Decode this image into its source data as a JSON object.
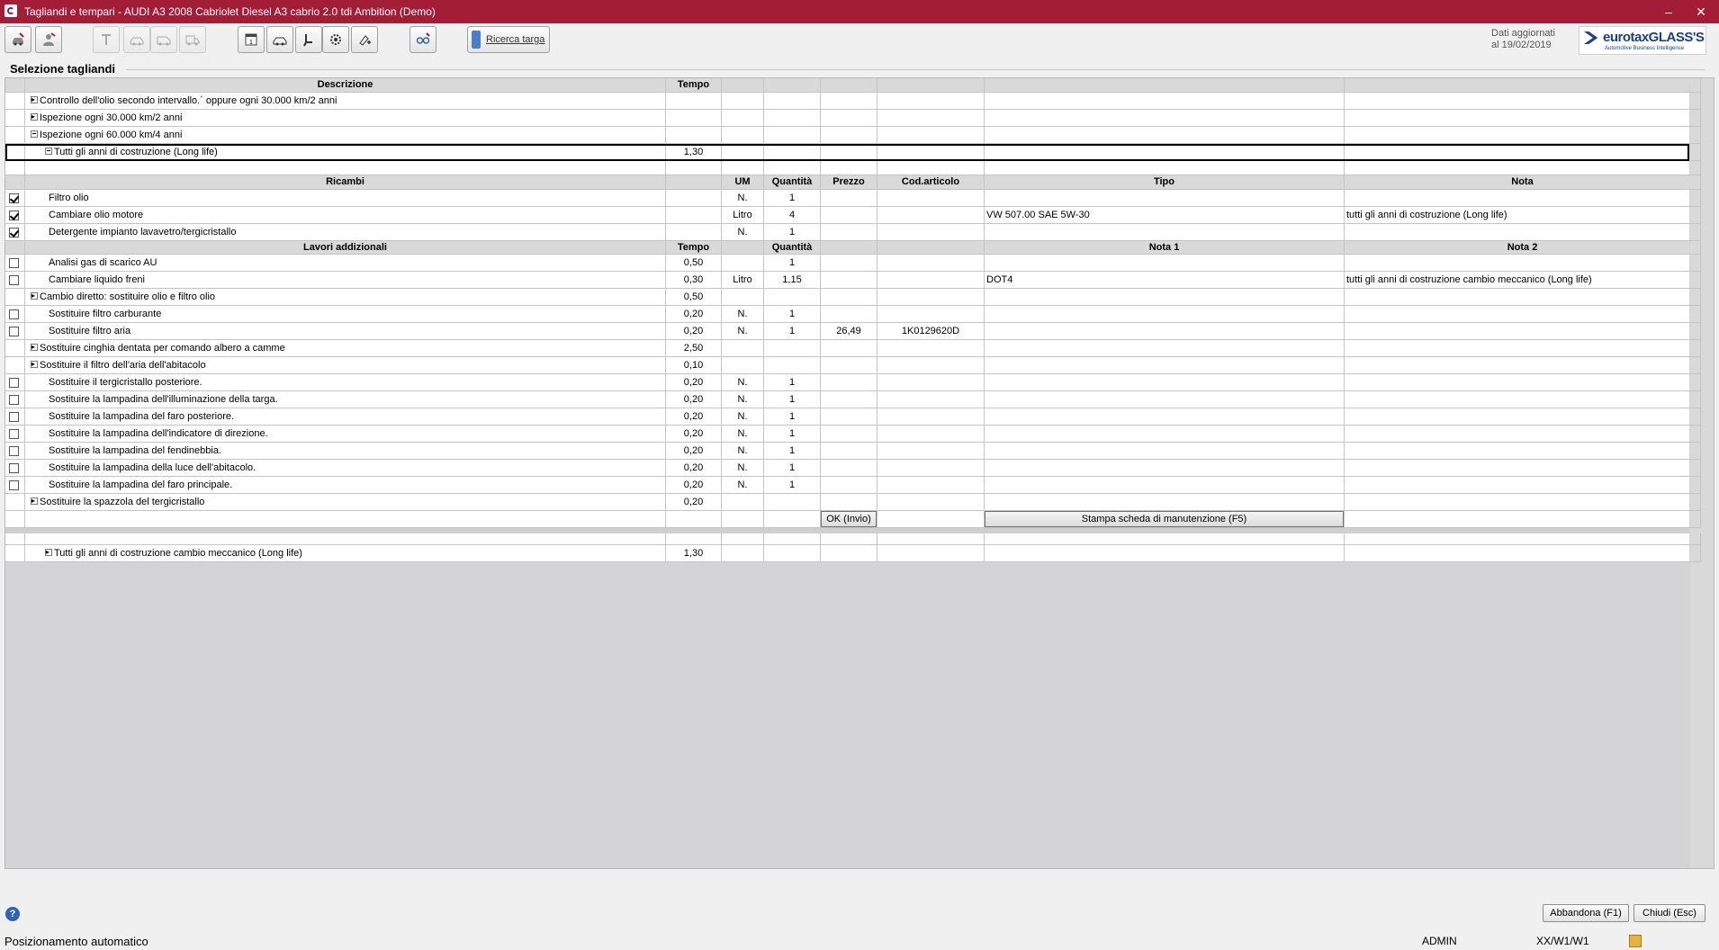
{
  "window": {
    "title": "Tagliandi e tempari - AUDI A3 2008 Cabriolet Diesel A3 cabrio 2.0 tdi Ambition  (Demo)",
    "minimize_icon": "minimize-icon",
    "close_icon": "close-icon"
  },
  "toolbar": {
    "ricerca_label": "Ricerca targa",
    "calendar_day": "1",
    "dati_line1": "Dati aggiornati",
    "dati_line2": "al 19/02/2019",
    "logo_text": "eurotaxGLASS'S",
    "logo_subtitle": "Automotive Business Intelligence"
  },
  "section": {
    "title": "Selezione tagliandi"
  },
  "grid": {
    "header": {
      "descrizione": "Descrizione",
      "tempo": "Tempo"
    },
    "intervals": [
      {
        "label": "Controllo dell'olio secondo intervallo.´ oppure ogni 30.000 km/2 anni",
        "expand": "plus",
        "indent": 0,
        "tempo": ""
      },
      {
        "label": "Ispezione ogni 30.000 km/2 anni",
        "expand": "plus",
        "indent": 0,
        "tempo": ""
      },
      {
        "label": "Ispezione ogni 60.000 km/4 anni",
        "expand": "minus",
        "indent": 0,
        "tempo": ""
      },
      {
        "label": "Tutti gli anni di costruzione (Long life)",
        "expand": "minus",
        "indent": 1,
        "tempo": "1,30"
      }
    ],
    "ricambi_header": {
      "name": "Ricambi",
      "um": "UM",
      "quantita": "Quantità",
      "prezzo": "Prezzo",
      "cod": "Cod.articolo",
      "tipo": "Tipo",
      "nota": "Nota"
    },
    "ricambi": [
      {
        "checked": true,
        "label": "Filtro olio",
        "um": "N.",
        "qty": "1",
        "prezzo": "",
        "cod": "",
        "tipo": "",
        "nota": ""
      },
      {
        "checked": true,
        "label": "Cambiare olio motore",
        "um": "Litro",
        "qty": "4",
        "prezzo": "",
        "cod": "",
        "tipo": "VW 507.00 SAE 5W-30",
        "nota": "tutti gli anni di costruzione (Long life)"
      },
      {
        "checked": true,
        "label": "Detergente impianto lavavetro/tergicristallo",
        "um": "N.",
        "qty": "1",
        "prezzo": "",
        "cod": "",
        "tipo": "",
        "nota": ""
      }
    ],
    "lavori_header": {
      "name": "Lavori addizionali",
      "tempo": "Tempo",
      "quantita": "Quantità",
      "nota1": "Nota 1",
      "nota2": "Nota 2"
    },
    "lavori": [
      {
        "kind": "check",
        "label": "Analisi gas di scarico AU",
        "tempo": "0,50",
        "um": "",
        "qty": "1",
        "prezzo": "",
        "cod": "",
        "nota1": "",
        "nota2": ""
      },
      {
        "kind": "check",
        "label": "Cambiare liquido freni",
        "tempo": "0,30",
        "um": "Litro",
        "qty": "1,15",
        "prezzo": "",
        "cod": "",
        "nota1": "DOT4",
        "nota2": "tutti gli anni di costruzione cambio meccanico (Long life)"
      },
      {
        "kind": "expand",
        "label": "Cambio diretto: sostituire olio e filtro olio",
        "tempo": "0,50",
        "um": "",
        "qty": "",
        "prezzo": "",
        "cod": "",
        "nota1": "",
        "nota2": ""
      },
      {
        "kind": "check",
        "label": "Sostituire filtro carburante",
        "tempo": "0,20",
        "um": "N.",
        "qty": "1",
        "prezzo": "",
        "cod": "",
        "nota1": "",
        "nota2": ""
      },
      {
        "kind": "check",
        "label": "Sostituire filtro aria",
        "tempo": "0,20",
        "um": "N.",
        "qty": "1",
        "prezzo": "26,49",
        "cod": "1K0129620D",
        "nota1": "",
        "nota2": ""
      },
      {
        "kind": "expand",
        "label": "Sostituire cinghia dentata per comando albero a camme",
        "tempo": "2,50",
        "um": "",
        "qty": "",
        "prezzo": "",
        "cod": "",
        "nota1": "",
        "nota2": ""
      },
      {
        "kind": "expand",
        "label": "Sostituire il filtro dell'aria dell'abitacolo",
        "tempo": "0,10",
        "um": "",
        "qty": "",
        "prezzo": "",
        "cod": "",
        "nota1": "",
        "nota2": ""
      },
      {
        "kind": "check",
        "label": "Sostituire il tergicristallo posteriore.",
        "tempo": "0,20",
        "um": "N.",
        "qty": "1",
        "prezzo": "",
        "cod": "",
        "nota1": "",
        "nota2": ""
      },
      {
        "kind": "check",
        "label": "Sostituire la lampadina dell'illuminazione della targa.",
        "tempo": "0,20",
        "um": "N.",
        "qty": "1",
        "prezzo": "",
        "cod": "",
        "nota1": "",
        "nota2": ""
      },
      {
        "kind": "check",
        "label": "Sostituire la lampadina del faro posteriore.",
        "tempo": "0,20",
        "um": "N.",
        "qty": "1",
        "prezzo": "",
        "cod": "",
        "nota1": "",
        "nota2": ""
      },
      {
        "kind": "check",
        "label": "Sostituire la lampadina dell'indicatore di direzione.",
        "tempo": "0,20",
        "um": "N.",
        "qty": "1",
        "prezzo": "",
        "cod": "",
        "nota1": "",
        "nota2": ""
      },
      {
        "kind": "check",
        "label": "Sostituire la lampadina del fendinebbia.",
        "tempo": "0,20",
        "um": "N.",
        "qty": "1",
        "prezzo": "",
        "cod": "",
        "nota1": "",
        "nota2": ""
      },
      {
        "kind": "check",
        "label": "Sostituire la lampadina della luce dell'abitacolo.",
        "tempo": "0,20",
        "um": "N.",
        "qty": "1",
        "prezzo": "",
        "cod": "",
        "nota1": "",
        "nota2": ""
      },
      {
        "kind": "check",
        "label": "Sostituire la lampadina del faro principale.",
        "tempo": "0,20",
        "um": "N.",
        "qty": "1",
        "prezzo": "",
        "cod": "",
        "nota1": "",
        "nota2": ""
      },
      {
        "kind": "expand",
        "label": "Sostituire la spazzola del tergicristallo",
        "tempo": "0,20",
        "um": "",
        "qty": "",
        "prezzo": "",
        "cod": "",
        "nota1": "",
        "nota2": ""
      }
    ],
    "ok_button": "OK (Invio)",
    "stampa_button": "Stampa scheda di manutenzione (F5)",
    "other_interval": {
      "label": "Tutti gli anni di costruzione cambio meccanico (Long life)",
      "tempo": "1,30"
    }
  },
  "footer": {
    "help_icon": "?",
    "abbandona": "Abbandona (F1)",
    "chiudi": "Chiudi (Esc)",
    "status_left": "Posizionamento automatico",
    "user": "ADMIN",
    "code": "XX/W1/W1"
  },
  "colors": {
    "titlebar": "#a31d36",
    "header_row": "#d9d9d9",
    "grid_bg": "#d4d4d6"
  }
}
